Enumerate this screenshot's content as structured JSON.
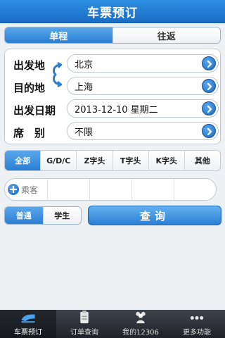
{
  "header": {
    "title": "车票预订"
  },
  "trip_type": {
    "options": [
      "单程",
      "往返"
    ],
    "selected": "单程"
  },
  "form": {
    "from_label": "出发地",
    "from_value": "北京",
    "to_label": "目的地",
    "to_value": "上海",
    "date_label": "出发日期",
    "date_value": "2013-12-10 星期二",
    "seat_label": "席　别",
    "seat_value": "不限"
  },
  "train_filter": {
    "options": [
      "全部",
      "G/D/C",
      "Z字头",
      "T字头",
      "K字头",
      "其他"
    ],
    "selected": "全部"
  },
  "passenger": {
    "add_label": "乘客"
  },
  "ticket_type": {
    "options": [
      "普通",
      "学生"
    ],
    "selected": "普通"
  },
  "search": {
    "label": "查询"
  },
  "tabbar": {
    "tabs": [
      {
        "label": "车票预订",
        "icon": "train-icon"
      },
      {
        "label": "订单查询",
        "icon": "clipboard-icon"
      },
      {
        "label": "我的12306",
        "icon": "users-icon"
      },
      {
        "label": "更多功能",
        "icon": "more-icon"
      }
    ],
    "selected": "车票预订"
  },
  "colors": {
    "accent": "#2a7fd2",
    "header": "#1a6cc4",
    "tabbar": "#2a2e33"
  }
}
